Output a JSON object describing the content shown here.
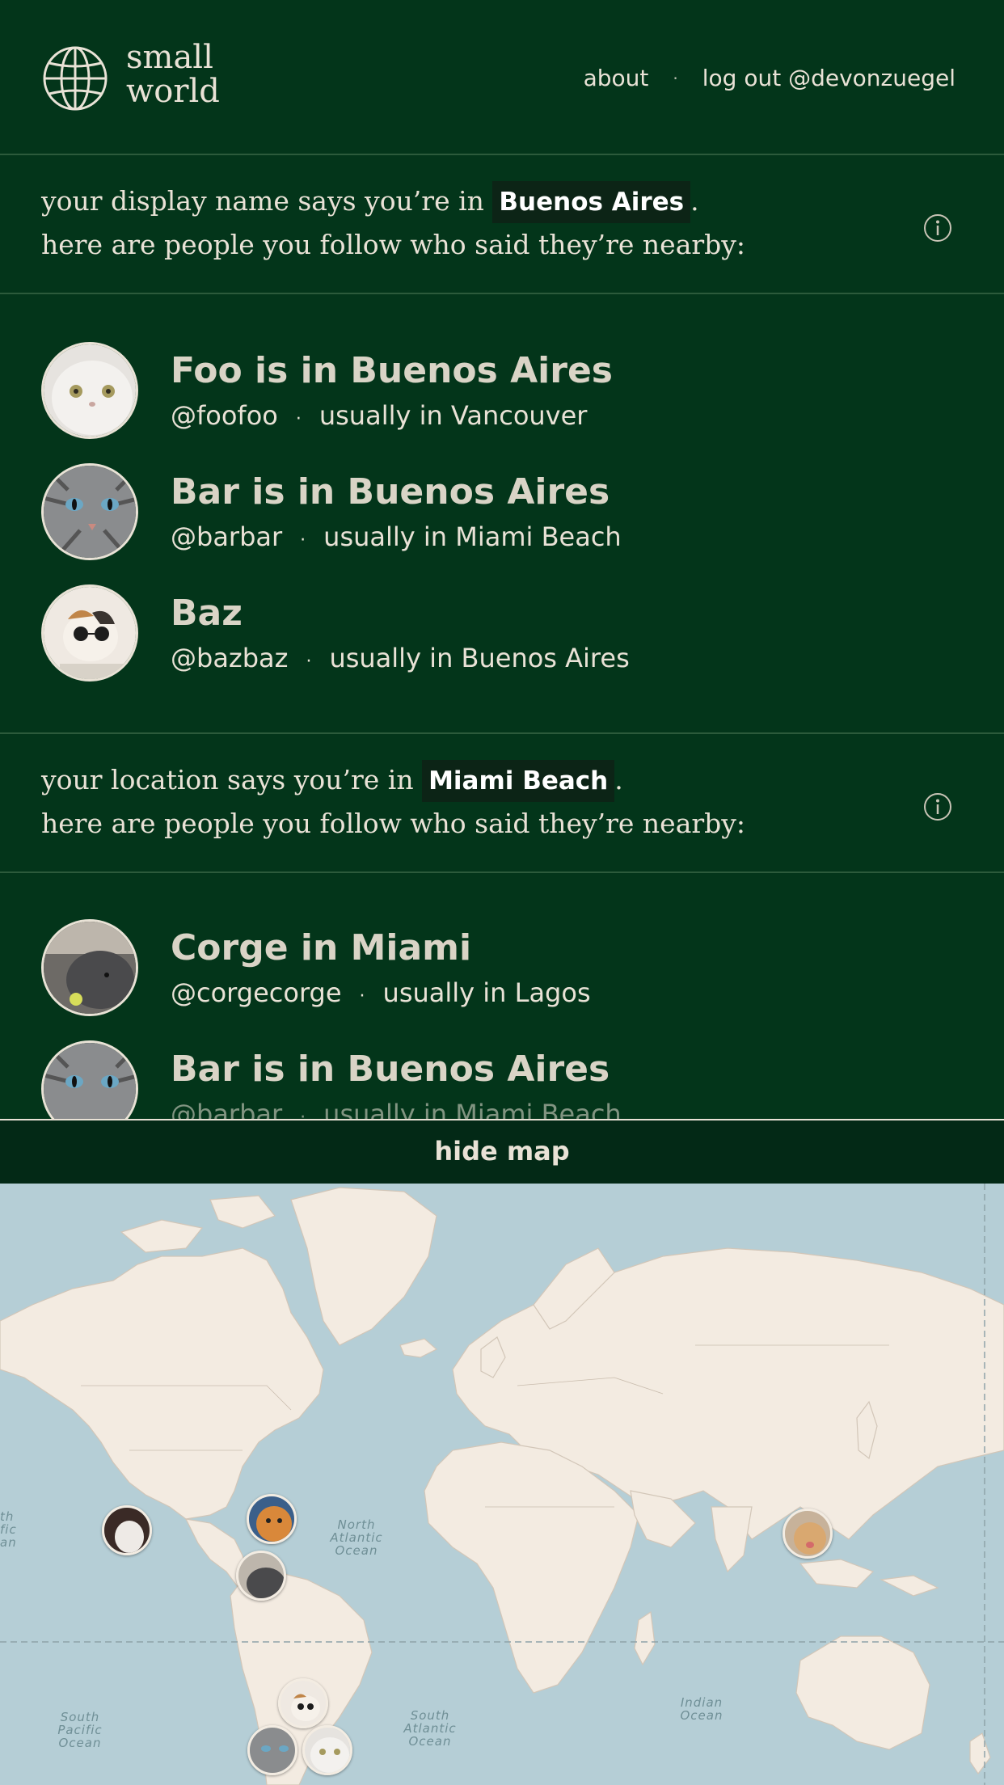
{
  "header": {
    "logo_line1": "small",
    "logo_line2": "world",
    "nav_about": "about",
    "nav_sep": "·",
    "nav_logout": "log out @devonzuegel"
  },
  "display_section": {
    "prefix": "your display name says you’re in",
    "location": "Buenos Aires",
    "suffix": ".",
    "line2": "here are people you follow who said they’re nearby:",
    "people": [
      {
        "title": "Foo is in Buenos Aires",
        "handle": "@foofoo",
        "usual": "usually in Vancouver"
      },
      {
        "title": "Bar is in Buenos Aires",
        "handle": "@barbar",
        "usual": "usually in Miami Beach"
      },
      {
        "title": "Baz",
        "handle": "@bazbaz",
        "usual": "usually in Buenos Aires"
      }
    ]
  },
  "location_section": {
    "prefix": "your location says you’re in",
    "location": "Miami Beach",
    "suffix": ".",
    "line2": "here are people you follow who said they’re nearby:",
    "people": [
      {
        "title": "Corge in Miami",
        "handle": "@corgecorge",
        "usual": "usually in Lagos"
      },
      {
        "title": "Bar is in Buenos Aires",
        "handle": "@barbar",
        "usual": "usually in Miami Beach"
      }
    ]
  },
  "sep": "·",
  "map": {
    "toggle_label": "hide map",
    "ocean_labels": {
      "north_atlantic": "North Atlantic Ocean",
      "south_atlantic": "South Atlantic Ocean",
      "south_pacific": "South Pacific Ocean",
      "indian": "Indian Ocean",
      "left_edge": "th fic an"
    }
  },
  "colors": {
    "background": "#03351a",
    "text": "#e9e2d6",
    "badge": "#0c2416",
    "map_water": "#b5ced6",
    "map_land": "#f3ebe1"
  }
}
